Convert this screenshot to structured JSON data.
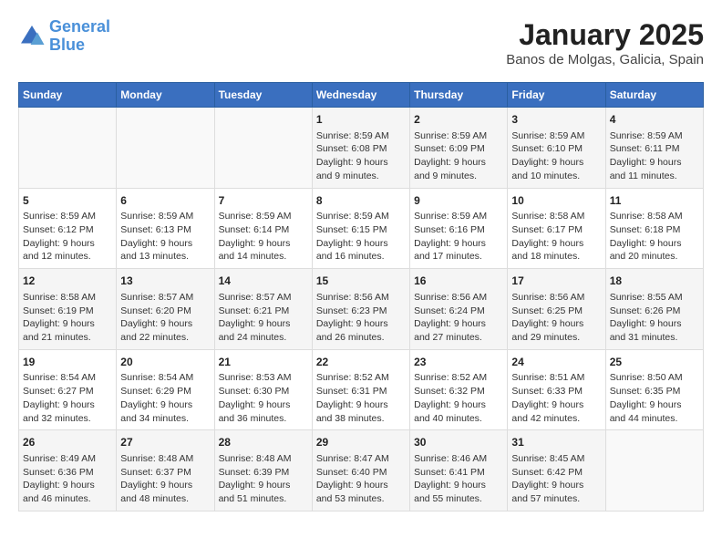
{
  "logo": {
    "line1": "General",
    "line2": "Blue"
  },
  "title": "January 2025",
  "subtitle": "Banos de Molgas, Galicia, Spain",
  "weekdays": [
    "Sunday",
    "Monday",
    "Tuesday",
    "Wednesday",
    "Thursday",
    "Friday",
    "Saturday"
  ],
  "weeks": [
    [
      {
        "day": "",
        "detail": ""
      },
      {
        "day": "",
        "detail": ""
      },
      {
        "day": "",
        "detail": ""
      },
      {
        "day": "1",
        "detail": "Sunrise: 8:59 AM\nSunset: 6:08 PM\nDaylight: 9 hours\nand 9 minutes."
      },
      {
        "day": "2",
        "detail": "Sunrise: 8:59 AM\nSunset: 6:09 PM\nDaylight: 9 hours\nand 9 minutes."
      },
      {
        "day": "3",
        "detail": "Sunrise: 8:59 AM\nSunset: 6:10 PM\nDaylight: 9 hours\nand 10 minutes."
      },
      {
        "day": "4",
        "detail": "Sunrise: 8:59 AM\nSunset: 6:11 PM\nDaylight: 9 hours\nand 11 minutes."
      }
    ],
    [
      {
        "day": "5",
        "detail": "Sunrise: 8:59 AM\nSunset: 6:12 PM\nDaylight: 9 hours\nand 12 minutes."
      },
      {
        "day": "6",
        "detail": "Sunrise: 8:59 AM\nSunset: 6:13 PM\nDaylight: 9 hours\nand 13 minutes."
      },
      {
        "day": "7",
        "detail": "Sunrise: 8:59 AM\nSunset: 6:14 PM\nDaylight: 9 hours\nand 14 minutes."
      },
      {
        "day": "8",
        "detail": "Sunrise: 8:59 AM\nSunset: 6:15 PM\nDaylight: 9 hours\nand 16 minutes."
      },
      {
        "day": "9",
        "detail": "Sunrise: 8:59 AM\nSunset: 6:16 PM\nDaylight: 9 hours\nand 17 minutes."
      },
      {
        "day": "10",
        "detail": "Sunrise: 8:58 AM\nSunset: 6:17 PM\nDaylight: 9 hours\nand 18 minutes."
      },
      {
        "day": "11",
        "detail": "Sunrise: 8:58 AM\nSunset: 6:18 PM\nDaylight: 9 hours\nand 20 minutes."
      }
    ],
    [
      {
        "day": "12",
        "detail": "Sunrise: 8:58 AM\nSunset: 6:19 PM\nDaylight: 9 hours\nand 21 minutes."
      },
      {
        "day": "13",
        "detail": "Sunrise: 8:57 AM\nSunset: 6:20 PM\nDaylight: 9 hours\nand 22 minutes."
      },
      {
        "day": "14",
        "detail": "Sunrise: 8:57 AM\nSunset: 6:21 PM\nDaylight: 9 hours\nand 24 minutes."
      },
      {
        "day": "15",
        "detail": "Sunrise: 8:56 AM\nSunset: 6:23 PM\nDaylight: 9 hours\nand 26 minutes."
      },
      {
        "day": "16",
        "detail": "Sunrise: 8:56 AM\nSunset: 6:24 PM\nDaylight: 9 hours\nand 27 minutes."
      },
      {
        "day": "17",
        "detail": "Sunrise: 8:56 AM\nSunset: 6:25 PM\nDaylight: 9 hours\nand 29 minutes."
      },
      {
        "day": "18",
        "detail": "Sunrise: 8:55 AM\nSunset: 6:26 PM\nDaylight: 9 hours\nand 31 minutes."
      }
    ],
    [
      {
        "day": "19",
        "detail": "Sunrise: 8:54 AM\nSunset: 6:27 PM\nDaylight: 9 hours\nand 32 minutes."
      },
      {
        "day": "20",
        "detail": "Sunrise: 8:54 AM\nSunset: 6:29 PM\nDaylight: 9 hours\nand 34 minutes."
      },
      {
        "day": "21",
        "detail": "Sunrise: 8:53 AM\nSunset: 6:30 PM\nDaylight: 9 hours\nand 36 minutes."
      },
      {
        "day": "22",
        "detail": "Sunrise: 8:52 AM\nSunset: 6:31 PM\nDaylight: 9 hours\nand 38 minutes."
      },
      {
        "day": "23",
        "detail": "Sunrise: 8:52 AM\nSunset: 6:32 PM\nDaylight: 9 hours\nand 40 minutes."
      },
      {
        "day": "24",
        "detail": "Sunrise: 8:51 AM\nSunset: 6:33 PM\nDaylight: 9 hours\nand 42 minutes."
      },
      {
        "day": "25",
        "detail": "Sunrise: 8:50 AM\nSunset: 6:35 PM\nDaylight: 9 hours\nand 44 minutes."
      }
    ],
    [
      {
        "day": "26",
        "detail": "Sunrise: 8:49 AM\nSunset: 6:36 PM\nDaylight: 9 hours\nand 46 minutes."
      },
      {
        "day": "27",
        "detail": "Sunrise: 8:48 AM\nSunset: 6:37 PM\nDaylight: 9 hours\nand 48 minutes."
      },
      {
        "day": "28",
        "detail": "Sunrise: 8:48 AM\nSunset: 6:39 PM\nDaylight: 9 hours\nand 51 minutes."
      },
      {
        "day": "29",
        "detail": "Sunrise: 8:47 AM\nSunset: 6:40 PM\nDaylight: 9 hours\nand 53 minutes."
      },
      {
        "day": "30",
        "detail": "Sunrise: 8:46 AM\nSunset: 6:41 PM\nDaylight: 9 hours\nand 55 minutes."
      },
      {
        "day": "31",
        "detail": "Sunrise: 8:45 AM\nSunset: 6:42 PM\nDaylight: 9 hours\nand 57 minutes."
      },
      {
        "day": "",
        "detail": ""
      }
    ]
  ]
}
